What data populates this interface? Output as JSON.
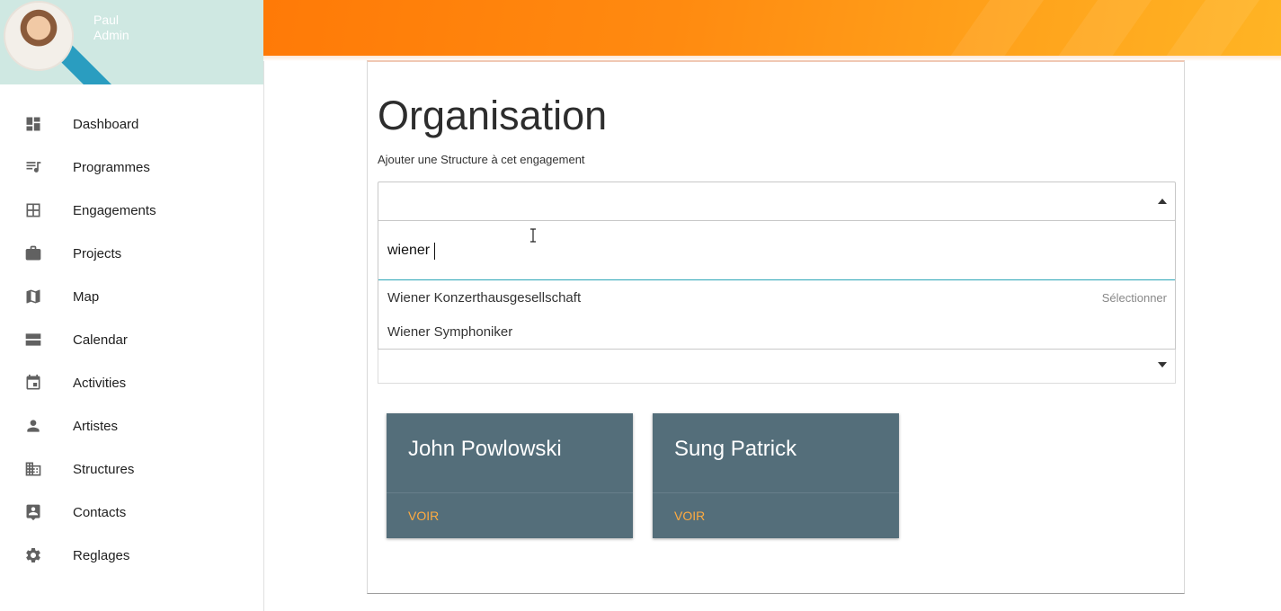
{
  "user": {
    "first_name": "Paul",
    "role": "Admin"
  },
  "nav": [
    {
      "label": "Dashboard",
      "icon": "dashboard-icon"
    },
    {
      "label": "Programmes",
      "icon": "queue-music-icon"
    },
    {
      "label": "Engagements",
      "icon": "grid-icon"
    },
    {
      "label": "Projects",
      "icon": "briefcase-icon"
    },
    {
      "label": "Map",
      "icon": "map-icon"
    },
    {
      "label": "Calendar",
      "icon": "calendar-view-icon"
    },
    {
      "label": "Activities",
      "icon": "event-icon"
    },
    {
      "label": "Artistes",
      "icon": "person-icon"
    },
    {
      "label": "Structures",
      "icon": "building-icon"
    },
    {
      "label": "Contacts",
      "icon": "contact-card-icon"
    },
    {
      "label": "Reglages",
      "icon": "gear-icon"
    }
  ],
  "page": {
    "title": "Organisation",
    "subtitle": "Ajouter une Structure à cet engagement"
  },
  "structure_select": {
    "search_value": "wiener",
    "options": [
      {
        "label": "Wiener Konzerthausgesellschaft",
        "hint": "Sélectionner"
      },
      {
        "label": "Wiener Symphoniker",
        "hint": ""
      }
    ]
  },
  "people": [
    {
      "name": "John Powlowski",
      "action": "Voir"
    },
    {
      "name": "Sung Patrick",
      "action": "Voir"
    }
  ],
  "colors": {
    "banner_start": "#ff7a07",
    "banner_end": "#ffb424",
    "card_bg": "#546e7a",
    "action_accent": "#ffab40",
    "focus_underline": "#2aa5b6"
  }
}
